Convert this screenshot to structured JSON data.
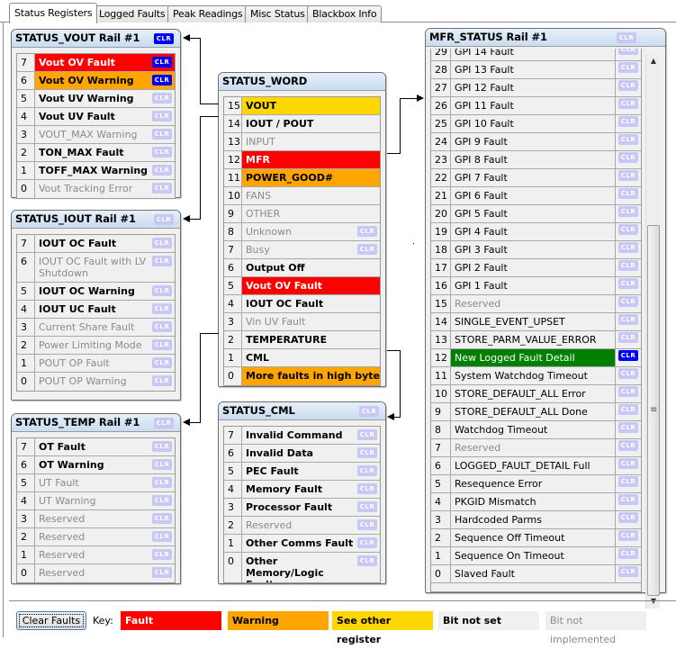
{
  "tabs": [
    {
      "label": "Status Registers",
      "active": true
    },
    {
      "label": "Logged Faults",
      "active": false
    },
    {
      "label": "Peak Readings",
      "active": false
    },
    {
      "label": "Misc Status",
      "active": false
    },
    {
      "label": "Blackbox Info",
      "active": false
    }
  ],
  "clr_label": "CLR",
  "colors": {
    "fault": "#ff0000",
    "warning": "#ffa500",
    "see_other_register": "#ffd700",
    "bit_not_set": "#f0f0f0",
    "new_logged_fault": "#008000",
    "clr_active": "#0000ff",
    "clr_inactive": "#c8c8f5"
  },
  "status_vout": {
    "title": "STATUS_VOUT Rail #1",
    "clr_active": true,
    "rows": [
      {
        "bit": "7",
        "label": "Vout OV Fault",
        "state": "fault",
        "clr_active": true
      },
      {
        "bit": "6",
        "label": "Vout OV Warning",
        "state": "warn",
        "clr_active": true
      },
      {
        "bit": "5",
        "label": "Vout UV Warning",
        "state": "set",
        "clr_active": false
      },
      {
        "bit": "4",
        "label": "Vout UV Fault",
        "state": "set",
        "clr_active": false
      },
      {
        "bit": "3",
        "label": "VOUT_MAX Warning",
        "state": "notimpl",
        "clr_active": false
      },
      {
        "bit": "2",
        "label": "TON_MAX Fault",
        "state": "set",
        "clr_active": false
      },
      {
        "bit": "1",
        "label": "TOFF_MAX Warning",
        "state": "set",
        "clr_active": false
      },
      {
        "bit": "0",
        "label": "Vout Tracking Error",
        "state": "notimpl",
        "clr_active": false
      }
    ]
  },
  "status_iout": {
    "title": "STATUS_IOUT Rail #1",
    "clr_active": false,
    "rows": [
      {
        "bit": "7",
        "label": "IOUT OC Fault",
        "state": "set"
      },
      {
        "bit": "6",
        "label": "IOUT OC Fault with LV Shutdown",
        "state": "notimpl"
      },
      {
        "bit": "5",
        "label": "IOUT OC Warning",
        "state": "set"
      },
      {
        "bit": "4",
        "label": "IOUT UC Fault",
        "state": "set"
      },
      {
        "bit": "3",
        "label": "Current Share Fault",
        "state": "notimpl"
      },
      {
        "bit": "2",
        "label": "Power Limiting Mode",
        "state": "notimpl"
      },
      {
        "bit": "1",
        "label": "POUT OP Fault",
        "state": "notimpl"
      },
      {
        "bit": "0",
        "label": "POUT OP Warning",
        "state": "notimpl"
      }
    ]
  },
  "status_temp": {
    "title": "STATUS_TEMP Rail #1",
    "clr_active": false,
    "rows": [
      {
        "bit": "7",
        "label": "OT Fault",
        "state": "set"
      },
      {
        "bit": "6",
        "label": "OT Warning",
        "state": "set"
      },
      {
        "bit": "5",
        "label": "UT Fault",
        "state": "notimpl"
      },
      {
        "bit": "4",
        "label": "UT Warning",
        "state": "notimpl"
      },
      {
        "bit": "3",
        "label": "Reserved",
        "state": "notimpl"
      },
      {
        "bit": "2",
        "label": "Reserved",
        "state": "notimpl"
      },
      {
        "bit": "1",
        "label": "Reserved",
        "state": "notimpl"
      },
      {
        "bit": "0",
        "label": "Reserved",
        "state": "notimpl"
      }
    ]
  },
  "status_word": {
    "title": "STATUS_WORD",
    "rows": [
      {
        "bit": "15",
        "label": "VOUT",
        "state": "other",
        "clr": false
      },
      {
        "bit": "14",
        "label": "IOUT / POUT",
        "state": "set",
        "clr": false
      },
      {
        "bit": "13",
        "label": "INPUT",
        "state": "notimpl",
        "clr": false
      },
      {
        "bit": "12",
        "label": "MFR",
        "state": "fault",
        "clr": false
      },
      {
        "bit": "11",
        "label": "POWER_GOOD#",
        "state": "warn",
        "clr": false
      },
      {
        "bit": "10",
        "label": "FANS",
        "state": "notimpl",
        "clr": false
      },
      {
        "bit": "9",
        "label": "OTHER",
        "state": "notimpl",
        "clr": false
      },
      {
        "bit": "8",
        "label": "Unknown",
        "state": "notimpl",
        "clr": true
      },
      {
        "bit": "7",
        "label": "Busy",
        "state": "notimpl",
        "clr": true
      },
      {
        "bit": "6",
        "label": "Output Off",
        "state": "set",
        "clr": false
      },
      {
        "bit": "5",
        "label": "Vout OV Fault",
        "state": "fault",
        "clr": false
      },
      {
        "bit": "4",
        "label": "IOUT OC Fault",
        "state": "set",
        "clr": false
      },
      {
        "bit": "3",
        "label": "Vin UV Fault",
        "state": "notimpl",
        "clr": false
      },
      {
        "bit": "2",
        "label": "TEMPERATURE",
        "state": "set",
        "clr": false
      },
      {
        "bit": "1",
        "label": "CML",
        "state": "set",
        "clr": false
      },
      {
        "bit": "0",
        "label": "More faults in high byte",
        "state": "warn",
        "clr": false
      }
    ]
  },
  "status_cml": {
    "title": "STATUS_CML",
    "clr_active": false,
    "rows": [
      {
        "bit": "7",
        "label": "Invalid Command",
        "state": "set"
      },
      {
        "bit": "6",
        "label": "Invalid Data",
        "state": "set"
      },
      {
        "bit": "5",
        "label": "PEC Fault",
        "state": "set"
      },
      {
        "bit": "4",
        "label": "Memory Fault",
        "state": "set"
      },
      {
        "bit": "3",
        "label": "Processor Fault",
        "state": "set"
      },
      {
        "bit": "2",
        "label": "Reserved",
        "state": "notimpl"
      },
      {
        "bit": "1",
        "label": "Other Comms Fault",
        "state": "set"
      },
      {
        "bit": "0",
        "label": "Other Memory/Logic Fault",
        "state": "set"
      }
    ]
  },
  "mfr_status": {
    "title": "MFR_STATUS Rail #1",
    "clr_active": false,
    "rows": [
      {
        "bit": "29",
        "label": "GPI 14 Fault",
        "state": "plain",
        "clr_active": false
      },
      {
        "bit": "28",
        "label": "GPI 13 Fault",
        "state": "plain",
        "clr_active": false
      },
      {
        "bit": "27",
        "label": "GPI 12 Fault",
        "state": "plain",
        "clr_active": false
      },
      {
        "bit": "26",
        "label": "GPI 11 Fault",
        "state": "plain",
        "clr_active": false
      },
      {
        "bit": "25",
        "label": "GPI 10 Fault",
        "state": "plain",
        "clr_active": false
      },
      {
        "bit": "24",
        "label": "GPI 9 Fault",
        "state": "plain",
        "clr_active": false
      },
      {
        "bit": "23",
        "label": "GPI 8 Fault",
        "state": "plain",
        "clr_active": false
      },
      {
        "bit": "22",
        "label": "GPI 7 Fault",
        "state": "plain",
        "clr_active": false
      },
      {
        "bit": "21",
        "label": "GPI 6 Fault",
        "state": "plain",
        "clr_active": false
      },
      {
        "bit": "20",
        "label": "GPI 5 Fault",
        "state": "plain",
        "clr_active": false
      },
      {
        "bit": "19",
        "label": "GPI 4 Fault",
        "state": "plain",
        "clr_active": false
      },
      {
        "bit": "18",
        "label": "GPI 3 Fault",
        "state": "plain",
        "clr_active": false
      },
      {
        "bit": "17",
        "label": "GPI 2 Fault",
        "state": "plain",
        "clr_active": false
      },
      {
        "bit": "16",
        "label": "GPI 1 Fault",
        "state": "plain",
        "clr_active": false
      },
      {
        "bit": "15",
        "label": "Reserved",
        "state": "notimpl",
        "clr_active": false
      },
      {
        "bit": "14",
        "label": "SINGLE_EVENT_UPSET",
        "state": "plain",
        "clr_active": false
      },
      {
        "bit": "13",
        "label": "STORE_PARM_VALUE_ERROR",
        "state": "plain",
        "clr_active": false
      },
      {
        "bit": "12",
        "label": "New Logged Fault Detail",
        "state": "green",
        "clr_active": true
      },
      {
        "bit": "11",
        "label": "System Watchdog Timeout",
        "state": "plain",
        "clr_active": false
      },
      {
        "bit": "10",
        "label": "STORE_DEFAULT_ALL Error",
        "state": "plain",
        "clr_active": false
      },
      {
        "bit": "9",
        "label": "STORE_DEFAULT_ALL Done",
        "state": "plain",
        "clr_active": false
      },
      {
        "bit": "8",
        "label": "Watchdog Timeout",
        "state": "plain",
        "clr_active": false
      },
      {
        "bit": "7",
        "label": "Reserved",
        "state": "notimpl",
        "clr_active": false
      },
      {
        "bit": "6",
        "label": "LOGGED_FAULT_DETAIL Full",
        "state": "plain",
        "clr_active": false
      },
      {
        "bit": "5",
        "label": "Resequence Error",
        "state": "plain",
        "clr_active": false
      },
      {
        "bit": "4",
        "label": "PKGID Mismatch",
        "state": "plain",
        "clr_active": false
      },
      {
        "bit": "3",
        "label": "Hardcoded Parms",
        "state": "plain",
        "clr_active": false
      },
      {
        "bit": "2",
        "label": "Sequence Off Timeout",
        "state": "plain",
        "clr_active": false
      },
      {
        "bit": "1",
        "label": "Sequence On Timeout",
        "state": "plain",
        "clr_active": false
      },
      {
        "bit": "0",
        "label": "Slaved Fault",
        "state": "plain",
        "clr_active": false
      }
    ],
    "scrollbar": {
      "up_icon": "▲",
      "down_icon": "▼",
      "grip_icon": "≡"
    }
  },
  "footer": {
    "clear_button": "Clear Faults",
    "key_label": "Key:",
    "keys": [
      {
        "label": "Fault",
        "state": "fault"
      },
      {
        "label": "Warning",
        "state": "warn"
      },
      {
        "label": "See other register",
        "state": "other"
      },
      {
        "label": "Bit not set",
        "state": "set"
      },
      {
        "label": "Bit not implemented",
        "state": "notimpl"
      }
    ]
  }
}
